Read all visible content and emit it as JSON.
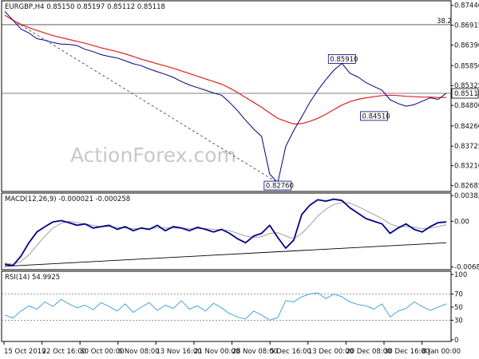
{
  "chart_data": [
    {
      "type": "line",
      "panel": "price",
      "title": "EURGBP,H4  0.85150 0.85197 0.85112 0.85118",
      "ylim": [
        0.8253,
        0.8756
      ],
      "y_ticks": [
        "0.87440",
        "0.86915",
        "0.86390",
        "0.85850",
        "0.85325",
        "0.84800",
        "0.84260",
        "0.83725",
        "0.83210",
        "0.82685"
      ],
      "y_tick_values": [
        0.8744,
        0.86915,
        0.8639,
        0.8585,
        0.85325,
        0.848,
        0.8426,
        0.83725,
        0.8321,
        0.82685
      ],
      "x_tick_labels": [
        "15 Oct 2019",
        "22 Oct 16:00",
        "30 Oct 00:00",
        "6 Nov 08:00",
        "13 Nov 16:00",
        "21 Nov 00:00",
        "28 Nov 08:00",
        "5 Dec 16:00",
        "13 Dec 00:00",
        "20 Dec 08:00",
        "30 Dec 16:00",
        "8 Jan 00:00"
      ],
      "series": [
        {
          "name": "EURGBP",
          "values": [
            0.8728,
            0.8705,
            0.8682,
            0.8671,
            0.8656,
            0.8652,
            0.8646,
            0.8642,
            0.8641,
            0.8638,
            0.8628,
            0.8622,
            0.8614,
            0.8609,
            0.8605,
            0.8598,
            0.859,
            0.8585,
            0.8576,
            0.8569,
            0.8562,
            0.8554,
            0.8543,
            0.8534,
            0.8527,
            0.852,
            0.8513,
            0.8507,
            0.8488,
            0.8466,
            0.8441,
            0.8418,
            0.8398,
            0.8299,
            0.8276,
            0.8372,
            0.8414,
            0.845,
            0.8488,
            0.852,
            0.8548,
            0.8573,
            0.8591,
            0.8565,
            0.8555,
            0.854,
            0.853,
            0.852,
            0.8495,
            0.8485,
            0.8478,
            0.8482,
            0.8491,
            0.85,
            0.8496,
            0.8512
          ]
        },
        {
          "name": "MA",
          "values": [
            0.8718,
            0.8705,
            0.8694,
            0.8685,
            0.8678,
            0.8671,
            0.8664,
            0.8659,
            0.8654,
            0.8649,
            0.8644,
            0.8638,
            0.8632,
            0.8627,
            0.8622,
            0.8616,
            0.8609,
            0.8602,
            0.8596,
            0.859,
            0.8584,
            0.8578,
            0.8571,
            0.8564,
            0.8557,
            0.855,
            0.8543,
            0.8536,
            0.8526,
            0.8514,
            0.8501,
            0.8488,
            0.8475,
            0.846,
            0.8446,
            0.8438,
            0.8431,
            0.8432,
            0.8438,
            0.8446,
            0.8457,
            0.8469,
            0.8481,
            0.849,
            0.8496,
            0.85,
            0.8503,
            0.8506,
            0.8507,
            0.8506,
            0.8504,
            0.8503,
            0.8502,
            0.8502,
            0.8501,
            0.8501
          ]
        }
      ],
      "hline_value": 0.8693,
      "hline_label": "38.2",
      "current_price_line": 0.85118,
      "annotations": [
        {
          "text": "0.85910",
          "value": 0.8591,
          "index": 42
        },
        {
          "text": "0.84510",
          "value": 0.8451,
          "index": 46
        },
        {
          "text": "0.82760",
          "value": 0.8276,
          "index": 34
        }
      ],
      "current_price_label": "0.85118",
      "colors": {
        "price": "#000080",
        "ma": "#e02020",
        "hline": "#444444",
        "trendline": "#333333"
      }
    },
    {
      "type": "line",
      "panel": "macd",
      "title": "MACD(12,26,9) -0.000021 -0.000258",
      "ylim": [
        -0.0072,
        0.0042
      ],
      "y_ticks": [
        "0.00382",
        "0.00",
        "-0.006803"
      ],
      "y_tick_values": [
        0.00382,
        0.0,
        -0.006803
      ],
      "series": [
        {
          "name": "MACD",
          "values": [
            -0.0064,
            -0.0066,
            -0.0052,
            -0.0032,
            -0.0016,
            -0.0008,
            -0.0001,
            0.0001,
            -0.0002,
            -0.0006,
            -0.0004,
            -0.001,
            -0.0008,
            -0.0006,
            -0.0012,
            -0.0008,
            -0.0014,
            -0.001,
            -0.0012,
            -0.0006,
            -0.0014,
            -0.0008,
            -0.001,
            -0.0014,
            -0.0009,
            -0.0012,
            -0.0016,
            -0.0012,
            -0.0018,
            -0.0026,
            -0.0032,
            -0.0022,
            -0.0018,
            -0.0006,
            -0.0024,
            -0.004,
            -0.0028,
            0.001,
            0.0024,
            0.0032,
            0.003,
            0.0033,
            0.0031,
            0.002,
            0.0012,
            0.0004,
            0.0,
            -0.0004,
            -0.0018,
            -0.001,
            -0.0004,
            -0.0012,
            -0.0016,
            -0.0008,
            -0.0002,
            -0.0001
          ]
        },
        {
          "name": "Signal",
          "values": [
            -0.0062,
            -0.0064,
            -0.006,
            -0.005,
            -0.0036,
            -0.0022,
            -0.001,
            -0.0003,
            0.0,
            -0.0002,
            -0.0004,
            -0.0006,
            -0.0008,
            -0.0008,
            -0.0009,
            -0.001,
            -0.0011,
            -0.0011,
            -0.0011,
            -0.001,
            -0.001,
            -0.001,
            -0.001,
            -0.0011,
            -0.0011,
            -0.0011,
            -0.0012,
            -0.0013,
            -0.0014,
            -0.0018,
            -0.0022,
            -0.0024,
            -0.0023,
            -0.0018,
            -0.0017,
            -0.0022,
            -0.0026,
            -0.0018,
            -0.0006,
            0.0008,
            0.0018,
            0.0025,
            0.0028,
            0.0027,
            0.0022,
            0.0016,
            0.001,
            0.0004,
            -0.0004,
            -0.0008,
            -0.0008,
            -0.0009,
            -0.0011,
            -0.001,
            -0.0008,
            -0.0005
          ]
        }
      ],
      "trendline": [
        [
          0,
          -0.0067
        ],
        [
          55,
          -0.0032
        ]
      ],
      "colors": {
        "macd": "#00008b",
        "signal": "#a0a0a0",
        "trendline": "#000000"
      }
    },
    {
      "type": "line",
      "panel": "rsi",
      "title": "RSI(14) 54.9925",
      "ylim": [
        0,
        100
      ],
      "y_ticks": [
        "100",
        "70",
        "50",
        "30",
        "0"
      ],
      "y_tick_values": [
        100,
        70,
        50,
        30,
        0
      ],
      "levels": [
        70,
        30
      ],
      "series": [
        {
          "name": "RSI",
          "values": [
            38,
            33,
            44,
            52,
            47,
            58,
            51,
            62,
            55,
            49,
            53,
            46,
            57,
            51,
            44,
            55,
            42,
            50,
            57,
            45,
            53,
            48,
            60,
            47,
            52,
            44,
            56,
            49,
            40,
            35,
            32,
            44,
            38,
            30,
            34,
            60,
            58,
            66,
            70,
            72,
            63,
            70,
            66,
            58,
            54,
            52,
            47,
            55,
            35,
            44,
            48,
            58,
            51,
            45,
            50,
            55
          ]
        }
      ],
      "colors": {
        "rsi": "#4aa3e0",
        "levels": "#777777"
      }
    }
  ],
  "watermark": "ActionForex.com"
}
